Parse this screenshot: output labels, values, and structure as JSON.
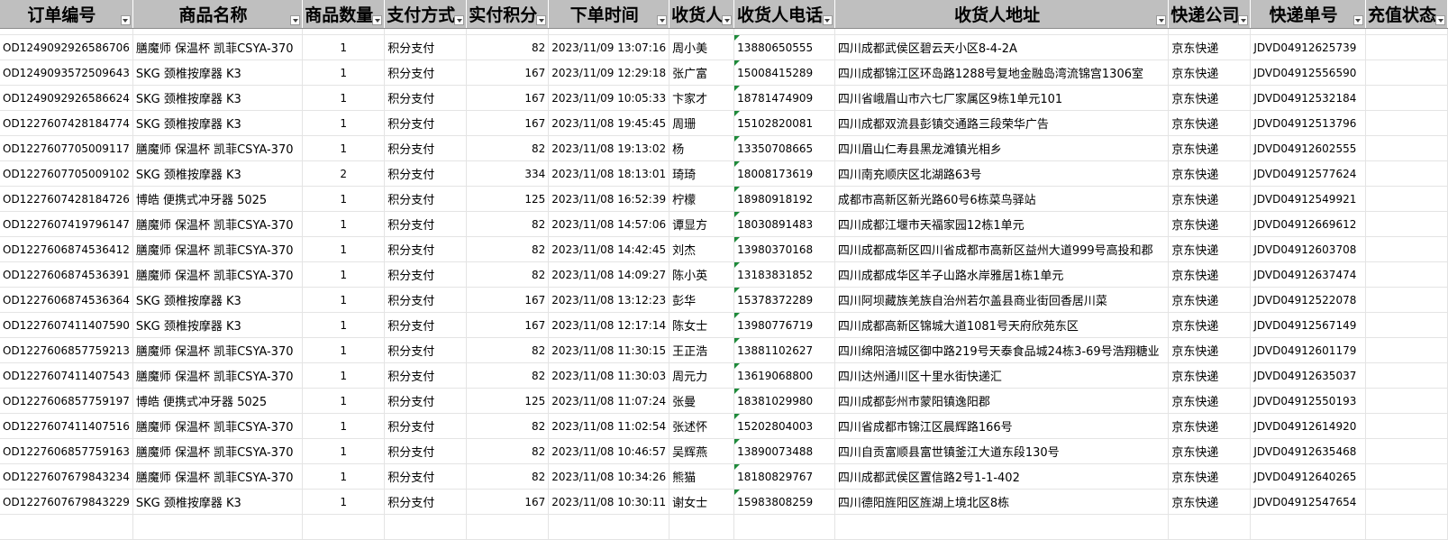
{
  "headers": [
    "订单编号",
    "商品名称",
    "商品数量",
    "支付方式",
    "实付积分",
    "下单时间",
    "收货人",
    "收货人电话",
    "收货人地址",
    "快递公司",
    "快递单号",
    "充值状态"
  ],
  "rows": [
    [
      "OD1249092926586706",
      "膳魔师 保温杯 凯菲CSYA-370",
      "1",
      "积分支付",
      "82",
      "2023/11/09 13:07:16",
      "周小美",
      "13880650555",
      "四川成都武侯区碧云天小区8-4-2A",
      "京东快递",
      "JDVD04912625739",
      ""
    ],
    [
      "OD1249093572509643",
      "SKG 颈椎按摩器 K3",
      "1",
      "积分支付",
      "167",
      "2023/11/09 12:29:18",
      "张广富",
      "15008415289",
      "四川成都锦江区环岛路1288号复地金融岛湾流锦宫1306室",
      "京东快递",
      "JDVD04912556590",
      ""
    ],
    [
      "OD1249092926586624",
      "SKG 颈椎按摩器 K3",
      "1",
      "积分支付",
      "167",
      "2023/11/09 10:05:33",
      "卞家才",
      "18781474909",
      "四川省峨眉山市六七厂家属区9栋1单元101",
      "京东快递",
      "JDVD04912532184",
      ""
    ],
    [
      "OD1227607428184774",
      "SKG 颈椎按摩器 K3",
      "1",
      "积分支付",
      "167",
      "2023/11/08 19:45:45",
      "周珊",
      "15102820081",
      "四川成都双流县彭镇交通路三段荣华广告",
      "京东快递",
      "JDVD04912513796",
      ""
    ],
    [
      "OD1227607705009117",
      "膳魔师 保温杯 凯菲CSYA-370",
      "1",
      "积分支付",
      "82",
      "2023/11/08 19:13:02",
      "杨",
      "13350708665",
      "四川眉山仁寿县黑龙滩镇光相乡",
      "京东快递",
      "JDVD04912602555",
      ""
    ],
    [
      "OD1227607705009102",
      "SKG 颈椎按摩器 K3",
      "2",
      "积分支付",
      "334",
      "2023/11/08 18:13:01",
      "琦琦",
      "18008173619",
      "四川南充顺庆区北湖路63号",
      "京东快递",
      "JDVD04912577624",
      ""
    ],
    [
      "OD1227607428184726",
      "博皓 便携式冲牙器 5025",
      "1",
      "积分支付",
      "125",
      "2023/11/08 16:52:39",
      "柠檬",
      "18980918192",
      "成都市高新区新光路60号6栋菜鸟驿站",
      "京东快递",
      "JDVD04912549921",
      ""
    ],
    [
      "OD1227607419796147",
      "膳魔师 保温杯 凯菲CSYA-370",
      "1",
      "积分支付",
      "82",
      "2023/11/08 14:57:06",
      "谭显方",
      "18030891483",
      "四川成都江堰市天福家园12栋1单元",
      "京东快递",
      "JDVD04912669612",
      ""
    ],
    [
      "OD1227606874536412",
      "膳魔师 保温杯 凯菲CSYA-370",
      "1",
      "积分支付",
      "82",
      "2023/11/08 14:42:45",
      "刘杰",
      "13980370168",
      "四川成都高新区四川省成都市高新区益州大道999号高投和郡",
      "京东快递",
      "JDVD04912603708",
      ""
    ],
    [
      "OD1227606874536391",
      "膳魔师 保温杯 凯菲CSYA-370",
      "1",
      "积分支付",
      "82",
      "2023/11/08 14:09:27",
      "陈小英",
      "13183831852",
      "四川成都成华区羊子山路水岸雅居1栋1单元",
      "京东快递",
      "JDVD04912637474",
      ""
    ],
    [
      "OD1227606874536364",
      "SKG 颈椎按摩器 K3",
      "1",
      "积分支付",
      "167",
      "2023/11/08 13:12:23",
      "彭华",
      "15378372289",
      "四川阿坝藏族羌族自治州若尔盖县商业街回香居川菜",
      "京东快递",
      "JDVD04912522078",
      ""
    ],
    [
      "OD1227607411407590",
      "SKG 颈椎按摩器 K3",
      "1",
      "积分支付",
      "167",
      "2023/11/08 12:17:14",
      "陈女士",
      "13980776719",
      "四川成都高新区锦城大道1081号天府欣苑东区",
      "京东快递",
      "JDVD04912567149",
      ""
    ],
    [
      "OD1227606857759213",
      "膳魔师 保温杯 凯菲CSYA-370",
      "1",
      "积分支付",
      "82",
      "2023/11/08 11:30:15",
      "王正浩",
      "13881102627",
      "四川绵阳涪城区御中路219号天泰食品城24栋3-69号浩翔糖业",
      "京东快递",
      "JDVD04912601179",
      ""
    ],
    [
      "OD1227607411407543",
      "膳魔师 保温杯 凯菲CSYA-370",
      "1",
      "积分支付",
      "82",
      "2023/11/08 11:30:03",
      "周元力",
      "13619068800",
      "四川达州通川区十里水街快递汇",
      "京东快递",
      "JDVD04912635037",
      ""
    ],
    [
      "OD1227606857759197",
      "博皓 便携式冲牙器 5025",
      "1",
      "积分支付",
      "125",
      "2023/11/08 11:07:24",
      "张曼",
      "18381029980",
      "四川成都彭州市蒙阳镇逸阳郡",
      "京东快递",
      "JDVD04912550193",
      ""
    ],
    [
      "OD1227607411407516",
      "膳魔师 保温杯 凯菲CSYA-370",
      "1",
      "积分支付",
      "82",
      "2023/11/08 11:02:54",
      "张述怀",
      "15202804003",
      "四川省成都市锦江区晨辉路166号",
      "京东快递",
      "JDVD04912614920",
      ""
    ],
    [
      "OD1227606857759163",
      "膳魔师 保温杯 凯菲CSYA-370",
      "1",
      "积分支付",
      "82",
      "2023/11/08 10:46:57",
      "吴辉燕",
      "13890073488",
      "四川自贡富顺县富世镇釜江大道东段130号",
      "京东快递",
      "JDVD04912635468",
      ""
    ],
    [
      "OD1227607679843234",
      "膳魔师 保温杯 凯菲CSYA-370",
      "1",
      "积分支付",
      "82",
      "2023/11/08 10:34:26",
      "熊猫",
      "18180829767",
      "四川成都武侯区置信路2号1-1-402",
      "京东快递",
      "JDVD04912640265",
      ""
    ],
    [
      "OD1227607679843229",
      "SKG 颈椎按摩器 K3",
      "1",
      "积分支付",
      "167",
      "2023/11/08 10:30:11",
      "谢女士",
      "15983808259",
      "四川德阳旌阳区旌湖上境北区8栋",
      "京东快递",
      "JDVD04912547654",
      ""
    ]
  ]
}
